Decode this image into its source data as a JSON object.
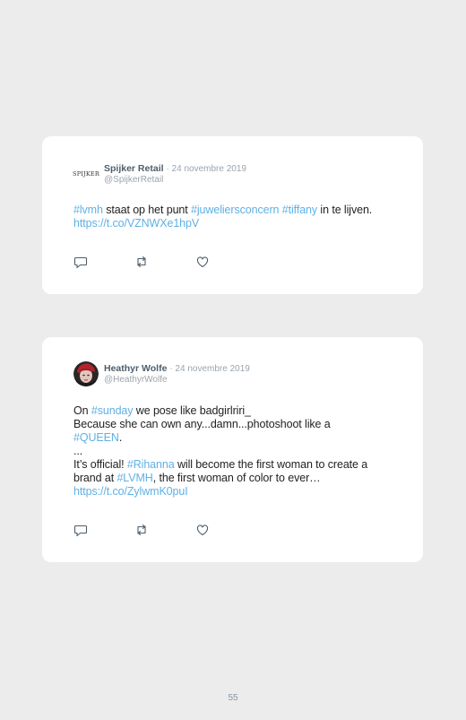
{
  "tweets": [
    {
      "author_name": "Spijker Retail",
      "date": "· 24 novembre 2019",
      "handle": "@SpijkerRetail",
      "avatar_text": "SPIJKER",
      "text_segments": [
        {
          "text": "#lvmh",
          "link": true
        },
        {
          "text": " staat op het punt ",
          "link": false
        },
        {
          "text": "#juweliersconcern",
          "link": true
        },
        {
          "text": " ",
          "link": false
        },
        {
          "text": "#tiffany",
          "link": true
        },
        {
          "text": " in te lijven. ",
          "link": false
        },
        {
          "text": "https://t.co/VZNWXe1hpV",
          "link": true
        }
      ]
    },
    {
      "author_name": "Heathyr Wolfe",
      "date": "· 24 novembre 2019",
      "handle": "@HeathyrWolfe",
      "text_segments": [
        {
          "text": "On ",
          "link": false
        },
        {
          "text": "#sunday",
          "link": true
        },
        {
          "text": " we pose like badgirlriri_",
          "link": false
        },
        {
          "text": "Because she can own any...damn...photoshoot like a",
          "link": false,
          "newline_before": true
        },
        {
          "text": "#QUEEN",
          "link": true,
          "newline_before": true
        },
        {
          "text": ".",
          "link": false
        },
        {
          "text": "...",
          "link": false,
          "newline_before": true
        },
        {
          "text": "It’s official! ",
          "link": false,
          "newline_before": true
        },
        {
          "text": "#Rihanna",
          "link": true
        },
        {
          "text": " will become the first woman to create a brand at ",
          "link": false
        },
        {
          "text": "#LVMH",
          "link": true
        },
        {
          "text": ", the first woman of color to ever… ",
          "link": false
        },
        {
          "text": "https://t.co/ZylwmK0puI",
          "link": true
        }
      ]
    }
  ],
  "page_number": "55",
  "colors": {
    "link": "#5fb0e4",
    "background": "#ececec",
    "card": "#ffffff",
    "meta": "#9aa4ad"
  },
  "icons": [
    "reply-icon",
    "retweet-icon",
    "like-icon"
  ]
}
